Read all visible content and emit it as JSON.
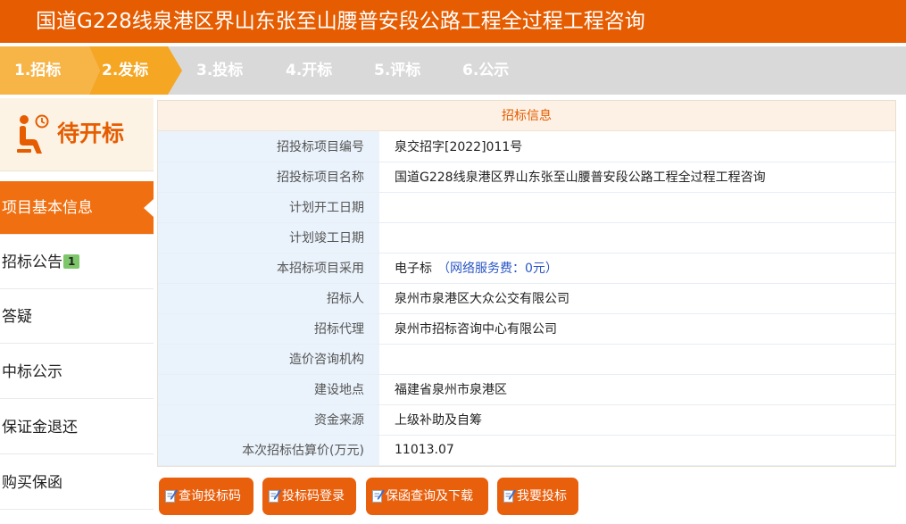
{
  "project_title": "国道G228线泉港区界山东张至山腰普安段公路工程全过程工程咨询",
  "steps": [
    {
      "label": "1.招标",
      "state": "done"
    },
    {
      "label": "2.发标",
      "state": "current"
    },
    {
      "label": "3.投标",
      "state": "pending"
    },
    {
      "label": "4.开标",
      "state": "pending"
    },
    {
      "label": "5.评标",
      "state": "pending"
    },
    {
      "label": "6.公示",
      "state": "pending"
    }
  ],
  "status": {
    "icon": "waiting-person-icon",
    "label": "待开标"
  },
  "sidebar": {
    "items": [
      {
        "label": "项目基本信息",
        "active": true
      },
      {
        "label": "招标公告",
        "badge": "1"
      },
      {
        "label": "答疑"
      },
      {
        "label": "中标公示"
      },
      {
        "label": "保证金退还"
      },
      {
        "label": "购买保函"
      }
    ]
  },
  "info": {
    "title": "招标信息",
    "rows": [
      {
        "label": "招投标项目编号",
        "value": "泉交招字[2022]011号"
      },
      {
        "label": "招投标项目名称",
        "value": "国道G228线泉港区界山东张至山腰普安段公路工程全过程工程咨询"
      },
      {
        "label": "计划开工日期",
        "value": ""
      },
      {
        "label": "计划竣工日期",
        "value": ""
      },
      {
        "label": "本招标项目采用",
        "value": "电子标",
        "note": "（网络服务费：0元）"
      },
      {
        "label": "招标人",
        "value": "泉州市泉港区大众公交有限公司"
      },
      {
        "label": "招标代理",
        "value": "泉州市招标咨询中心有限公司"
      },
      {
        "label": "造价咨询机构",
        "value": ""
      },
      {
        "label": "建设地点",
        "value": "福建省泉州市泉港区"
      },
      {
        "label": "资金来源",
        "value": "上级补助及自筹"
      },
      {
        "label": "本次招标估算价(万元)",
        "value": "11013.07"
      }
    ]
  },
  "actions": {
    "query_code": "查询投标码",
    "code_login": "投标码登录",
    "guarantee_download": "保函查询及下载",
    "bid": "我要投标"
  },
  "colors": {
    "brand_orange": "#e65c00",
    "step_done": "#f7b548",
    "step_current": "#f5a623",
    "steps_bg": "#d9d9d9",
    "menu_active": "#f07011",
    "label_bg": "#eaf2fb",
    "fee_blue": "#2b56c6",
    "badge_green": "#7ec66a"
  }
}
